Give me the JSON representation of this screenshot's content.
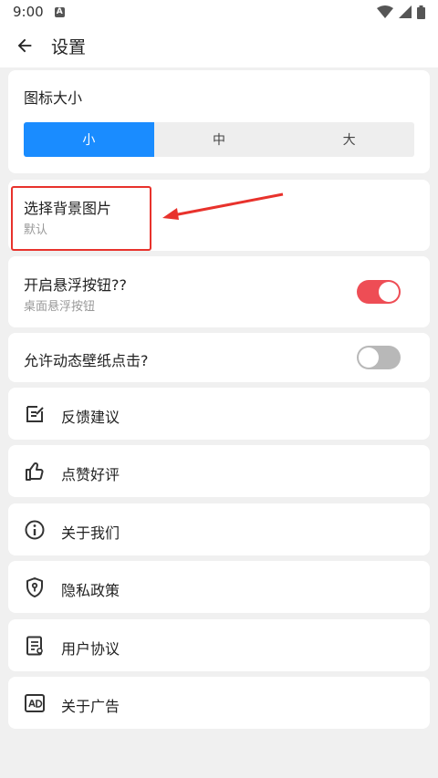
{
  "status_bar": {
    "time": "9:00",
    "notification_icon": "a-icon"
  },
  "app_bar": {
    "title": "设置",
    "back_icon": "arrow-left-icon"
  },
  "icon_size": {
    "title": "图标大小",
    "options": [
      "小",
      "中",
      "大"
    ],
    "selected": "小"
  },
  "background": {
    "title": "选择背景图片",
    "value": "默认"
  },
  "floating_button": {
    "title": "开启悬浮按钮??",
    "subtitle": "桌面悬浮按钮",
    "enabled": true
  },
  "live_wallpaper": {
    "title": "允许动态壁纸点击?",
    "enabled": false
  },
  "menu": [
    {
      "label": "反馈建议",
      "icon": "feedback-edit-icon"
    },
    {
      "label": "点赞好评",
      "icon": "thumbs-up-icon"
    },
    {
      "label": "关于我们",
      "icon": "info-icon"
    },
    {
      "label": "隐私政策",
      "icon": "shield-icon"
    },
    {
      "label": "用户协议",
      "icon": "document-icon"
    },
    {
      "label": "关于广告",
      "icon": "ad-icon"
    }
  ],
  "colors": {
    "accent": "#1a8cff",
    "toggle_on": "#ee4d55",
    "highlight": "#e8322c"
  }
}
